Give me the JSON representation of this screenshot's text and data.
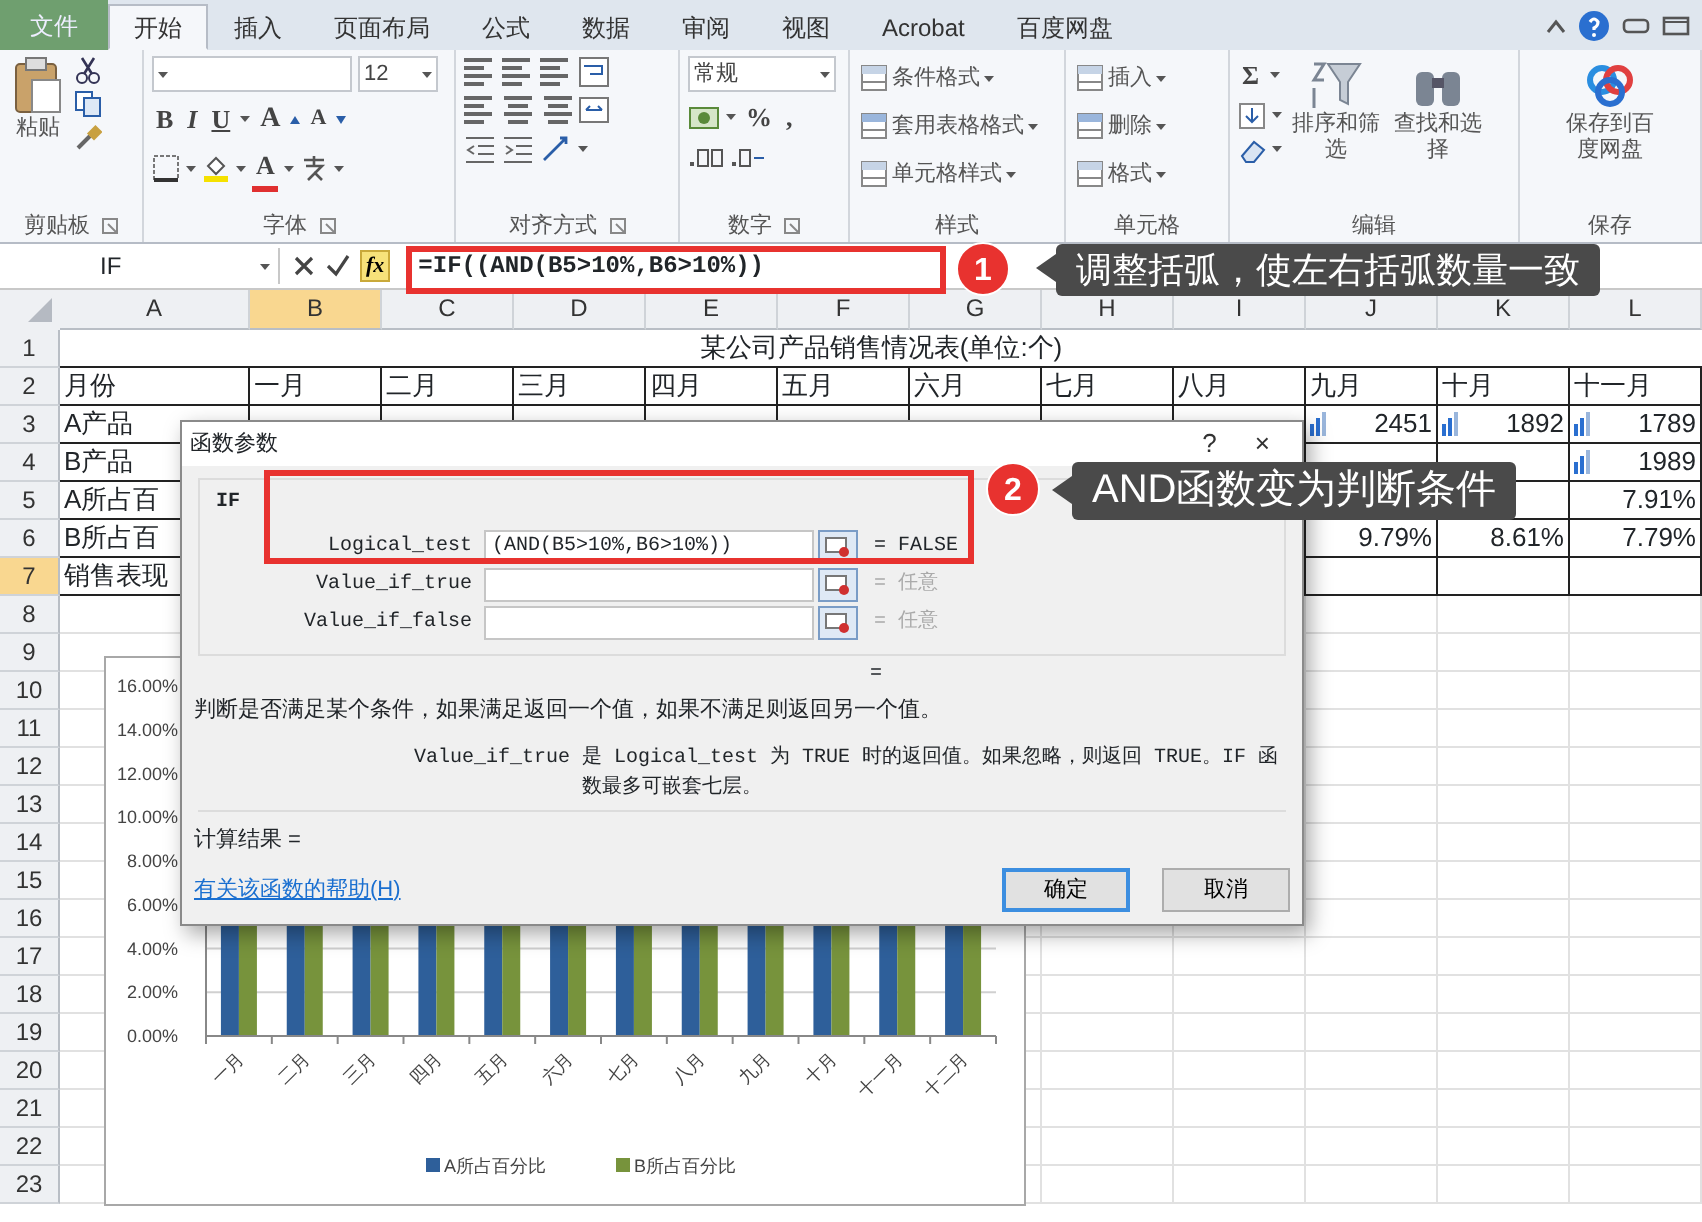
{
  "ribbon": {
    "tabs": [
      {
        "label": "文件",
        "kind": "file",
        "selected": false
      },
      {
        "label": "开始",
        "kind": "tab",
        "selected": true
      },
      {
        "label": "插入",
        "kind": "tab",
        "selected": false
      },
      {
        "label": "页面布局",
        "kind": "tab",
        "selected": false
      },
      {
        "label": "公式",
        "kind": "tab",
        "selected": false
      },
      {
        "label": "数据",
        "kind": "tab",
        "selected": false
      },
      {
        "label": "审阅",
        "kind": "tab",
        "selected": false
      },
      {
        "label": "视图",
        "kind": "tab",
        "selected": false
      },
      {
        "label": "Acrobat",
        "kind": "tab",
        "selected": false
      },
      {
        "label": "百度网盘",
        "kind": "tab",
        "selected": false
      }
    ],
    "groups": [
      {
        "kind": "clipboard",
        "label": "剪贴板",
        "paste": "粘贴"
      },
      {
        "kind": "font",
        "label": "字体",
        "font_size": "12",
        "buttons": [
          "B",
          "I",
          "U"
        ],
        "size_buttons": [
          "A",
          "A"
        ],
        "color_button": "A"
      },
      {
        "kind": "alignment",
        "label": "对齐方式"
      },
      {
        "kind": "number",
        "label": "数字",
        "format": "常规",
        "symbols": [
          "%",
          ","
        ]
      },
      {
        "kind": "styles",
        "label": "样式",
        "items": [
          "条件格式",
          "套用表格格式",
          "单元格样式"
        ]
      },
      {
        "kind": "cells",
        "label": "单元格",
        "items": [
          "插入",
          "删除",
          "格式"
        ]
      },
      {
        "kind": "editing",
        "label": "编辑",
        "sum": "Σ",
        "items": [
          "排序和筛选",
          "查找和选择"
        ]
      },
      {
        "kind": "save",
        "label": "保存",
        "item": "保存到百度网盘"
      }
    ]
  },
  "formula_bar": {
    "name_box": "IF",
    "insert_function": "fx",
    "formula": "=IF((AND(B5>10%,B6>10%))"
  },
  "sheet": {
    "columns": [
      {
        "label": "A",
        "selected": false
      },
      {
        "label": "B",
        "selected": true
      },
      {
        "label": "C",
        "selected": false
      },
      {
        "label": "D",
        "selected": false
      },
      {
        "label": "E",
        "selected": false
      },
      {
        "label": "F",
        "selected": false
      },
      {
        "label": "G",
        "selected": false
      },
      {
        "label": "H",
        "selected": false
      },
      {
        "label": "I",
        "selected": false
      },
      {
        "label": "J",
        "selected": false
      },
      {
        "label": "K",
        "selected": false
      },
      {
        "label": "L",
        "selected": false
      }
    ],
    "rows": [
      {
        "number": "1",
        "kind": "title",
        "selected": false,
        "title": "某公司产品销售情况表(单位:个)"
      },
      {
        "number": "2",
        "kind": "header",
        "selected": false,
        "cells": [
          "月份",
          "一月",
          "二月",
          "三月",
          "四月",
          "五月",
          "六月",
          "七月",
          "八月",
          "九月",
          "十月",
          "十一月"
        ]
      },
      {
        "number": "3",
        "kind": "table",
        "selected": false,
        "data_bars": true,
        "cells": [
          "A产品",
          null,
          null,
          null,
          null,
          null,
          null,
          null,
          null,
          "2451",
          "1892",
          "1789"
        ]
      },
      {
        "number": "4",
        "kind": "table",
        "selected": false,
        "data_bars": true,
        "cells": [
          "B产品",
          null,
          null,
          null,
          null,
          null,
          null,
          null,
          null,
          null,
          null,
          "1989"
        ]
      },
      {
        "number": "5",
        "kind": "table",
        "selected": false,
        "cells": [
          "A所占百",
          null,
          null,
          null,
          null,
          null,
          null,
          null,
          null,
          null,
          null,
          "7.91%"
        ]
      },
      {
        "number": "6",
        "kind": "table",
        "selected": false,
        "cells": [
          "B所占百",
          null,
          null,
          null,
          null,
          null,
          null,
          null,
          null,
          "9.79%",
          "8.61%",
          "7.79%"
        ]
      },
      {
        "number": "7",
        "kind": "table",
        "selected": true,
        "cells": [
          "销售表现",
          null,
          null,
          null,
          null,
          null,
          null,
          null,
          null,
          null,
          null,
          null
        ]
      },
      {
        "number": "8",
        "kind": "blank",
        "selected": false
      },
      {
        "number": "9",
        "kind": "blank",
        "selected": false
      },
      {
        "number": "10",
        "kind": "blank",
        "selected": false
      },
      {
        "number": "11",
        "kind": "blank",
        "selected": false
      },
      {
        "number": "12",
        "kind": "blank",
        "selected": false
      },
      {
        "number": "13",
        "kind": "blank",
        "selected": false
      },
      {
        "number": "14",
        "kind": "blank",
        "selected": false
      },
      {
        "number": "15",
        "kind": "blank",
        "selected": false
      },
      {
        "number": "16",
        "kind": "blank",
        "selected": false
      },
      {
        "number": "17",
        "kind": "blank",
        "selected": false
      },
      {
        "number": "18",
        "kind": "blank",
        "selected": false
      },
      {
        "number": "19",
        "kind": "blank",
        "selected": false
      },
      {
        "number": "20",
        "kind": "blank",
        "selected": false
      },
      {
        "number": "21",
        "kind": "blank",
        "selected": false
      },
      {
        "number": "22",
        "kind": "blank",
        "selected": false
      },
      {
        "number": "23",
        "kind": "blank",
        "selected": false
      }
    ]
  },
  "chart": {
    "y_labels": [
      "16.00%",
      "14.00%",
      "12.00%",
      "10.00%",
      "8.00%",
      "6.00%",
      "4.00%",
      "2.00%",
      "0.00%"
    ],
    "categories": [
      "一月",
      "二月",
      "三月",
      "四月",
      "五月",
      "六月",
      "七月",
      "八月",
      "九月",
      "十月",
      "十一月",
      "十二月"
    ],
    "legend": [
      {
        "name": "A所占百分比",
        "color": "#2e5f9a"
      },
      {
        "name": "B所占百分比",
        "color": "#77933c"
      }
    ]
  },
  "dialog": {
    "title": "函数参数",
    "help_button": "?",
    "close_button": "×",
    "function": "IF",
    "arguments": [
      {
        "label": "Logical_test",
        "value": "(AND(B5>10%,B6>10%))",
        "result": "= FALSE"
      },
      {
        "label": "Value_if_true",
        "result": "= 任意"
      },
      {
        "label": "Value_if_false",
        "result": "= 任意"
      }
    ],
    "formula_result": "=",
    "description": "判断是否满足某个条件，如果满足返回一个值，如果不满足则返回另一个值。",
    "argument_name": "Value_if_true",
    "argument_help": "是 Logical_test 为 TRUE 时的返回值。如果忽略，则返回 TRUE。IF 函数最多可嵌套七层。",
    "calc_result": "计算结果 =",
    "help_link": "有关该函数的帮助(H)",
    "buttons": [
      {
        "label": "确定",
        "default": true
      },
      {
        "label": "取消",
        "default": false
      }
    ]
  },
  "annotations": [
    {
      "number": "1",
      "text": "调整括弧，使左右括弧数量一致"
    },
    {
      "number": "2",
      "text": "AND函数变为判断条件"
    }
  ]
}
